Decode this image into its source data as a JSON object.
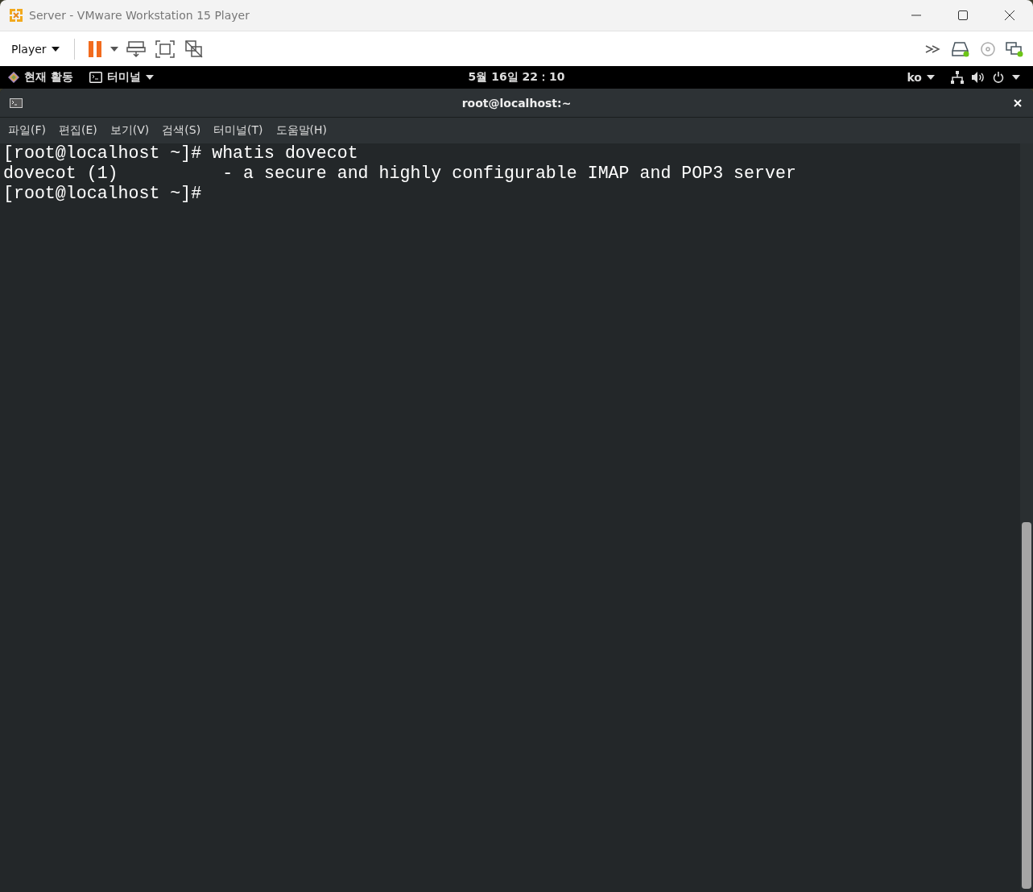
{
  "window": {
    "title": "Server - VMware Workstation 15 Player"
  },
  "toolbar": {
    "player_menu": "Player"
  },
  "top_bar": {
    "activities": "현재 활동",
    "app_menu": "터미널",
    "clock": "5월 16일  22：10",
    "input_method": "ko"
  },
  "terminal": {
    "title": "root@localhost:~",
    "menus": [
      {
        "label": "파일(F)"
      },
      {
        "label": "편집(E)"
      },
      {
        "label": "보기(V)"
      },
      {
        "label": "검색(S)"
      },
      {
        "label": "터미널(T)"
      },
      {
        "label": "도움말(H)"
      }
    ],
    "lines": [
      "[root@localhost ~]# whatis dovecot",
      "dovecot (1)          - a secure and highly configurable IMAP and POP3 server",
      "[root@localhost ~]#"
    ]
  }
}
